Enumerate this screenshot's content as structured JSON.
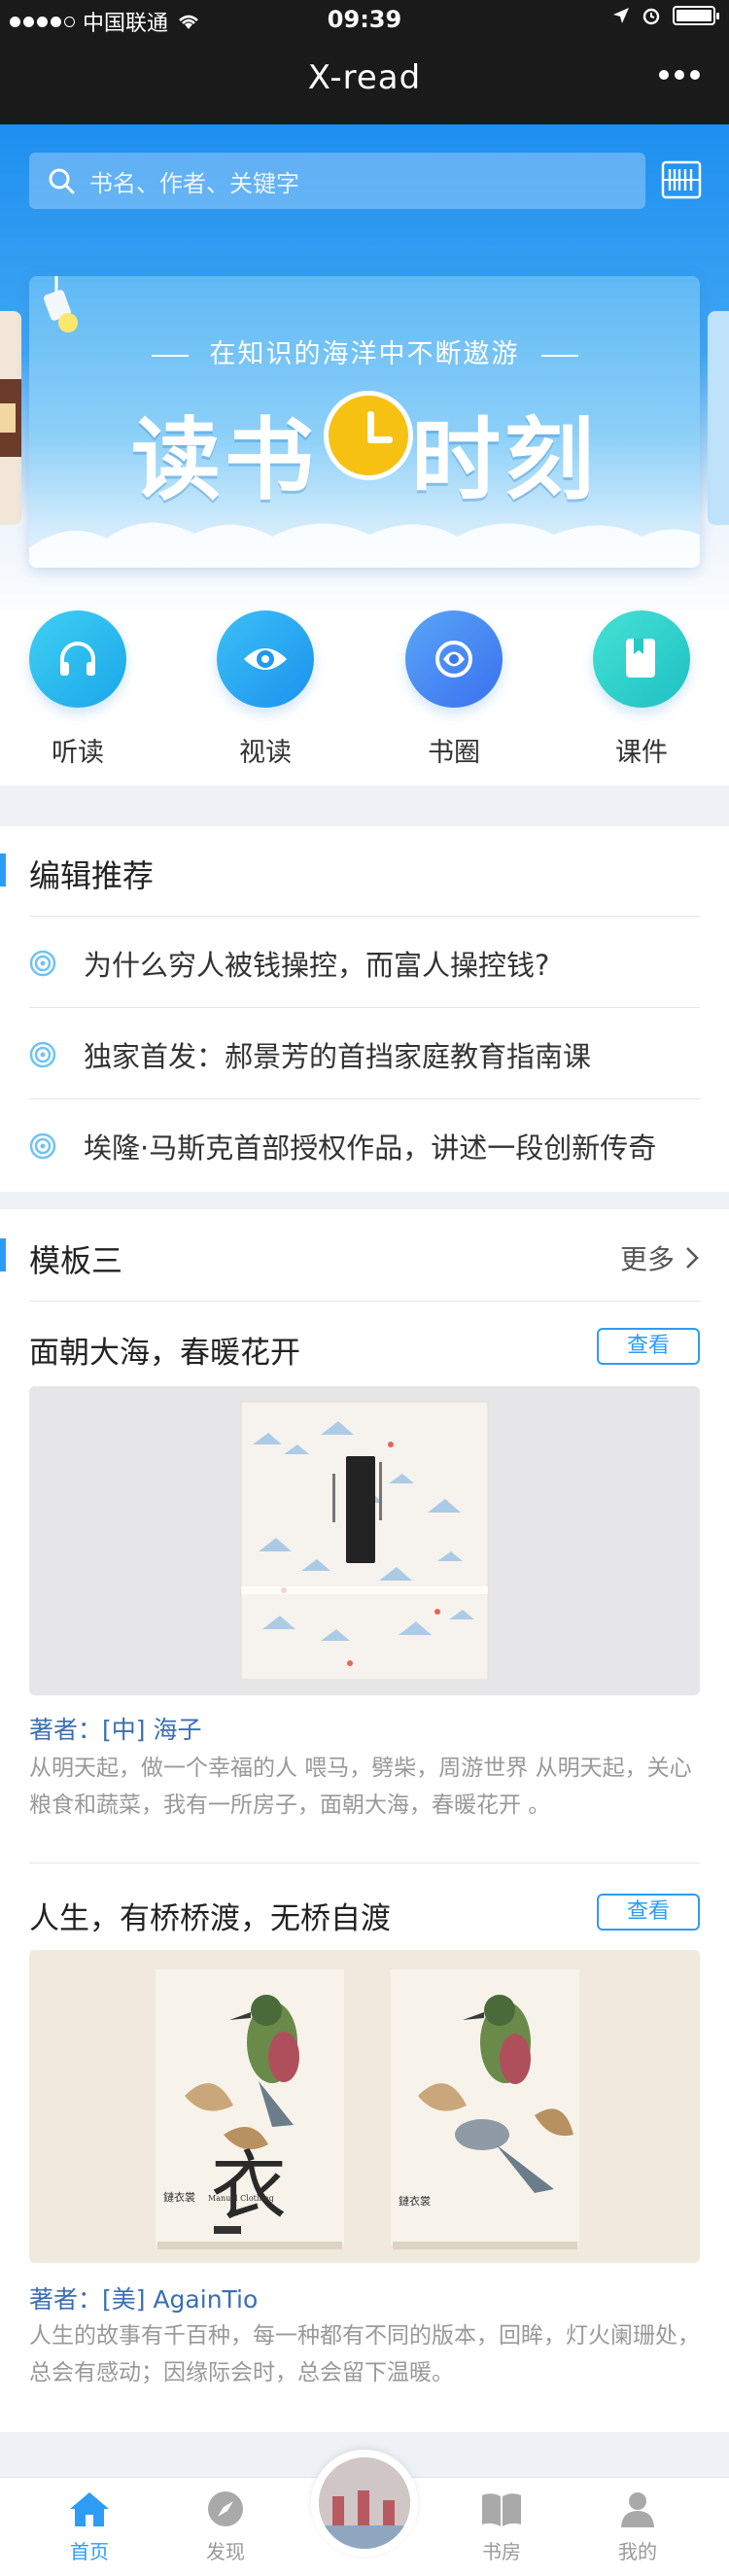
{
  "status": {
    "carrier": "中国联通",
    "time": "09:39"
  },
  "nav": {
    "title": "X-read"
  },
  "search": {
    "placeholder": "书名、作者、关键字"
  },
  "banner": {
    "subtitle": "在知识的海洋中不断遨游",
    "headline_left": "读书",
    "headline_right": "时刻"
  },
  "quick": [
    {
      "label": "听读",
      "icon": "headphones-icon",
      "color": "#26b7f0"
    },
    {
      "label": "视读",
      "icon": "eye-icon",
      "color": "#2aa4f4"
    },
    {
      "label": "书圈",
      "icon": "circle-logo-icon",
      "color": "#3f86f5"
    },
    {
      "label": "课件",
      "icon": "bookmark-book-icon",
      "color": "#25cfc8"
    }
  ],
  "recommend": {
    "title": "编辑推荐",
    "items": [
      "为什么穷人被钱操控，而富人操控钱?",
      "独家首发：郝景芳的首挡家庭教育指南课",
      "埃隆·马斯克首部授权作品，讲述一段创新传奇"
    ]
  },
  "template3": {
    "title": "模板三",
    "more": "更多",
    "books": [
      {
        "title": "面朝大海，春暖花开",
        "button": "查看",
        "author": "著者：[中] 海子",
        "desc": "从明天起，做一个幸福的人 喂马，劈柴，周游世界 从明天起，关心粮食和蔬菜，我有一所房子，面朝大海，春暖花开 。"
      },
      {
        "title": "人生，有桥桥渡，无桥自渡",
        "button": "查看",
        "author": "著者：[美] AgainTio",
        "desc": "人生的故事有千百种，每一种都有不同的版本，回眸，灯火阑珊处，总会有感动；因缘际会时，总会留下温暖。",
        "cover_char": "衣",
        "cover_text": "鏈衣裳",
        "cover_text_en": "Manual Clothing"
      }
    ]
  },
  "tabs": [
    {
      "label": "首页",
      "icon": "home-icon",
      "active": true
    },
    {
      "label": "发现",
      "icon": "compass-icon",
      "active": false
    },
    {
      "label": "书房",
      "icon": "open-book-icon",
      "active": false
    },
    {
      "label": "我的",
      "icon": "user-icon",
      "active": false
    }
  ],
  "colors": {
    "accent": "#2d9cf5",
    "topbar": "#1a1a1a",
    "author": "#3a6fb3"
  }
}
